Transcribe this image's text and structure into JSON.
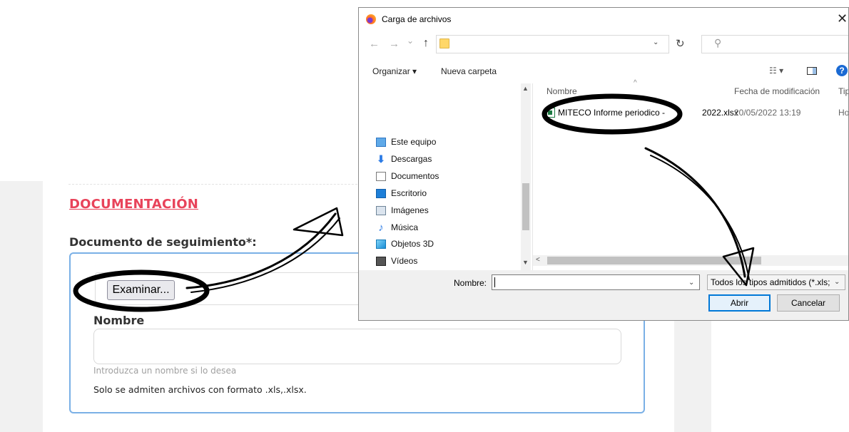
{
  "form": {
    "section_title": "DOCUMENTACIÓN",
    "field_label": "Documento de seguimiento*:",
    "browse_label": "Examinar...",
    "name_label": "Nombre",
    "name_help": "Introduzca un nombre si lo desea",
    "format_note": "Solo se admiten archivos con formato .xls,.xlsx."
  },
  "dialog": {
    "title": "Carga de archivos",
    "close": "✕",
    "nav": {
      "back": "←",
      "forward": "→",
      "recent": "⌄",
      "up": "↑",
      "address_dropdown": "⌄",
      "refresh": "↻",
      "search": "⚲"
    },
    "toolbar": {
      "organize": "Organizar ▾",
      "new_folder": "Nueva carpeta",
      "view": "☷ ▾",
      "help": "?"
    },
    "nav_pane": [
      {
        "label": "Este equipo",
        "icon": "computer-icon"
      },
      {
        "label": "Descargas",
        "icon": "download-icon"
      },
      {
        "label": "Documentos",
        "icon": "document-icon"
      },
      {
        "label": "Escritorio",
        "icon": "desktop-icon"
      },
      {
        "label": "Imágenes",
        "icon": "pictures-icon"
      },
      {
        "label": "Música",
        "icon": "music-icon"
      },
      {
        "label": "Objetos 3D",
        "icon": "3d-objects-icon"
      },
      {
        "label": "Vídeos",
        "icon": "videos-icon"
      }
    ],
    "columns": {
      "name": "Nombre",
      "date": "Fecha de modificación",
      "type": "Tip"
    },
    "files": [
      {
        "name": "MITECO Informe periodico -",
        "name_suffix": "2022.xlsx",
        "date": "20/05/2022 13:19",
        "type": "Ho"
      }
    ],
    "filename_label": "Nombre:",
    "filename_value": "",
    "filetype": "Todos los tipos admitidos (*.xls;",
    "open_label": "Abrir",
    "cancel_label": "Cancelar"
  },
  "colors": {
    "section_title": "#e8435a",
    "field_border": "#7ab0e6",
    "open_border": "#0078d7",
    "annotation": "#000000"
  }
}
